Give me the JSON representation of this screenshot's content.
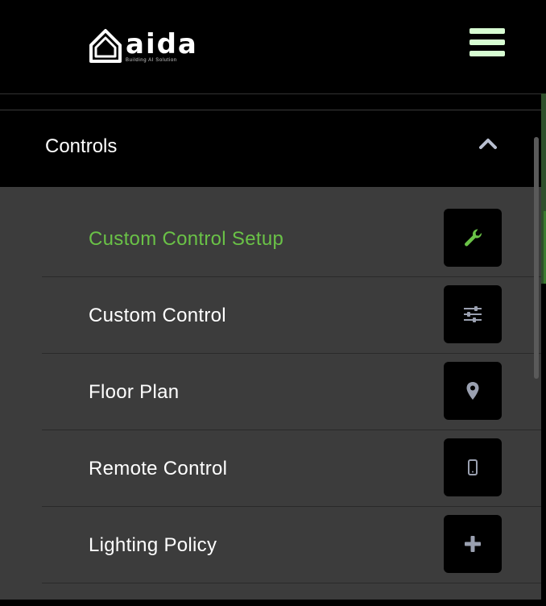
{
  "header": {
    "logo_text": "aida",
    "logo_tagline": "Building AI Solution",
    "menu_icon": "hamburger-menu-icon"
  },
  "controls": {
    "title": "Controls",
    "toggle_icon": "chevron-up-icon"
  },
  "menu_items": [
    {
      "label": "Custom Control Setup",
      "icon": "wrench-icon",
      "active": true
    },
    {
      "label": "Custom Control",
      "icon": "sliders-icon",
      "active": false
    },
    {
      "label": "Floor Plan",
      "icon": "map-pin-icon",
      "active": false
    },
    {
      "label": "Remote Control",
      "icon": "mobile-phone-icon",
      "active": false
    },
    {
      "label": "Lighting Policy",
      "icon": "plus-icon",
      "active": false
    }
  ],
  "colors": {
    "background": "#000000",
    "submenu_bg": "#3c3c3c",
    "active_text": "#6ac247",
    "menu_icon_color": "#d7fcd2",
    "icon_grey": "#9aa0b0"
  }
}
